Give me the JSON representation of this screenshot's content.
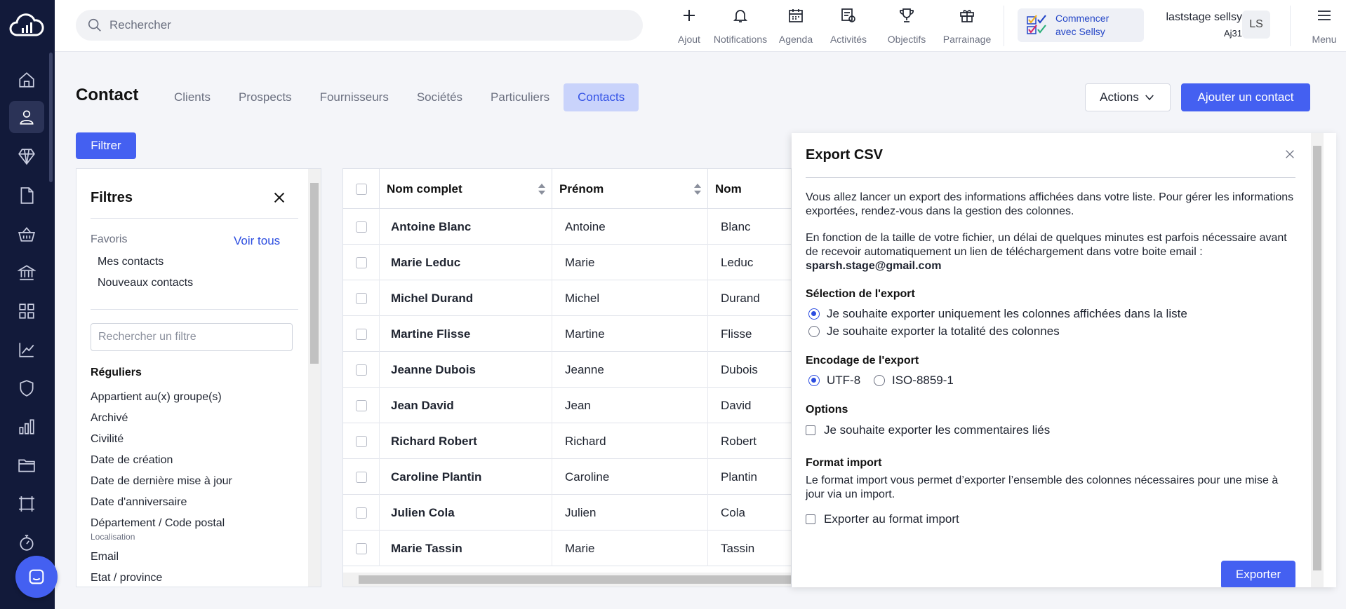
{
  "topbar": {
    "search_placeholder": "Rechercher",
    "items": [
      {
        "label": "Ajout",
        "icon": "plus-icon"
      },
      {
        "label": "Notifications",
        "icon": "bell-icon"
      },
      {
        "label": "Agenda",
        "icon": "calendar-icon"
      },
      {
        "label": "Activités",
        "icon": "activities-icon"
      },
      {
        "label": "Objectifs",
        "icon": "trophy-icon"
      },
      {
        "label": "Parrainage",
        "icon": "gift-icon"
      }
    ],
    "start_card": {
      "line1": "Commencer",
      "line2": "avec Sellsy"
    },
    "user": {
      "name": "laststage sellsy",
      "sub": "Aj31",
      "initials": "LS"
    },
    "menu_label": "Menu"
  },
  "sidebar": {
    "items": [
      {
        "icon": "home-icon"
      },
      {
        "icon": "contact-icon",
        "active": true
      },
      {
        "icon": "diamond-icon"
      },
      {
        "icon": "document-icon"
      },
      {
        "icon": "basket-icon"
      },
      {
        "icon": "bank-icon"
      },
      {
        "icon": "grid-icon"
      },
      {
        "icon": "chart-line-icon"
      },
      {
        "icon": "shield-icon"
      },
      {
        "icon": "bar-chart-icon"
      },
      {
        "icon": "folder-icon"
      },
      {
        "icon": "frame-icon"
      },
      {
        "icon": "stopwatch-icon"
      }
    ]
  },
  "page": {
    "title": "Contact",
    "tabs": [
      "Clients",
      "Prospects",
      "Fournisseurs",
      "Sociétés",
      "Particuliers",
      "Contacts"
    ],
    "active_tab": "Contacts",
    "actions_label": "Actions",
    "add_label": "Ajouter un contact",
    "filter_label": "Filtrer"
  },
  "filters": {
    "title": "Filtres",
    "favorites_label": "Favoris",
    "see_all": "Voir tous",
    "favorites": [
      "Mes contacts",
      "Nouveaux contacts"
    ],
    "search_placeholder": "Rechercher un filtre",
    "regular_label": "Réguliers",
    "items": [
      "Appartient au(x) groupe(s)",
      "Archivé",
      "Civilité",
      "Date de création",
      "Date de dernière mise à jour",
      "Date d'anniversaire",
      "Département / Code postal",
      "Localisation",
      "Email",
      "Etat / province"
    ]
  },
  "table": {
    "columns": [
      "Nom complet",
      "Prénom",
      "Nom"
    ],
    "rows": [
      {
        "full": "Antoine Blanc",
        "first": "Antoine",
        "last": "Blanc"
      },
      {
        "full": "Marie Leduc",
        "first": "Marie",
        "last": "Leduc"
      },
      {
        "full": "Michel Durand",
        "first": "Michel",
        "last": "Durand"
      },
      {
        "full": "Martine Flisse",
        "first": "Martine",
        "last": "Flisse"
      },
      {
        "full": "Jeanne Dubois",
        "first": "Jeanne",
        "last": "Dubois"
      },
      {
        "full": "Jean David",
        "first": "Jean",
        "last": "David"
      },
      {
        "full": "Richard Robert",
        "first": "Richard",
        "last": "Robert"
      },
      {
        "full": "Caroline Plantin",
        "first": "Caroline",
        "last": "Plantin"
      },
      {
        "full": "Julien Cola",
        "first": "Julien",
        "last": "Cola"
      },
      {
        "full": "Marie Tassin",
        "first": "Marie",
        "last": "Tassin"
      }
    ]
  },
  "export": {
    "title": "Export CSV",
    "intro": "Vous allez lancer un export des informations affichées dans votre liste. Pour gérer les informations exportées, rendez-vous dans la gestion des colonnes.",
    "delay": "En fonction de la taille de votre fichier, un délai de quelques minutes est parfois nécessaire avant de recevoir automatiquement un lien de téléchargement dans votre boite email :",
    "email": "sparsh.stage@gmail.com",
    "selection_title": "Sélection de l'export",
    "selection_options": [
      "Je souhaite exporter uniquement les colonnes affichées dans la liste",
      "Je souhaite exporter la totalité des colonnes"
    ],
    "selection_selected": 0,
    "encoding_title": "Encodage de l'export",
    "encoding_options": [
      "UTF-8",
      "ISO-8859-1"
    ],
    "encoding_selected": 0,
    "options_title": "Options",
    "options_checkbox": "Je souhaite exporter les commentaires liés",
    "format_title": "Format import",
    "format_text": "Le format import vous permet d’exporter l’ensemble des colonnes nécessaires pour une mise à jour via un import.",
    "format_checkbox": "Exporter au format import",
    "submit": "Exporter"
  },
  "colors": {
    "primary": "#4460f1",
    "sidebar": "#121a3a",
    "tab_active_bg": "#c9d3fb",
    "link": "#2c4de0"
  }
}
